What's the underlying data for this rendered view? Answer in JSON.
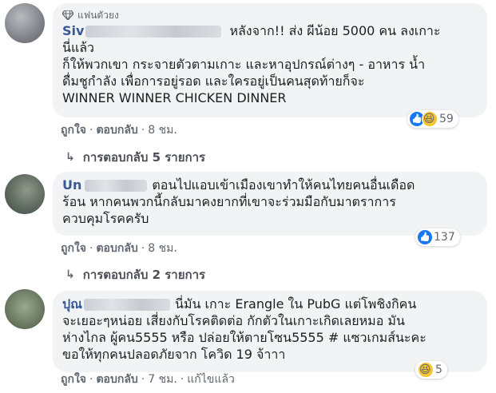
{
  "comments": [
    {
      "top_fan": "แฟนตัวยง",
      "name": "Siv",
      "text_line1": "หลังจาก!! ส่ง ผีน้อย 5000 คน ลงเกาะ",
      "text_lines": [
        "นี่แล้ว",
        "ก็ให้พวกเขา กระจายตัวตามเกาะ และหาอุปกรณ์ต่างๆ - อาหาร น้ำ",
        "ดื่มชูกำลัง เพื่อการอยู่รอด และใครอยู่เป็นคนสุดท้ายก็จะ",
        "WINNER WINNER CHICKEN DINNER"
      ],
      "reactions": [
        "like-icon",
        "haha-icon"
      ],
      "reaction_count": "59",
      "like": "ถูกใจ",
      "reply": "ตอบกลับ",
      "time": "8 ชม.",
      "replies_link": "การตอบกลับ 5 รายการ"
    },
    {
      "name": "Un",
      "text_line1": "ตอนไปแอบเข้าเมืองเขาทำให้คนไทยคนอื่นเดือด",
      "text_lines": [
        "ร้อน หากคนพวกนี้กลับมาคงยากที่เขาจะร่วมมือกับมาตราการ",
        "ควบคุมโรคครับ"
      ],
      "reactions": [
        "like-icon"
      ],
      "reaction_count": "137",
      "like": "ถูกใจ",
      "reply": "ตอบกลับ",
      "time": "8 ชม.",
      "replies_link": "การตอบกลับ 2 รายการ"
    },
    {
      "name": "ปุณ",
      "text_line1": "นี่มัน เกาะ Erangle ใน PubG แต่โพชิงกิคน",
      "text_lines": [
        "จะเยอะๆหน่อย เสี่ยงกับโรคติดต่อ กักตัวในเกาะเกิดเลยหมอ มัน",
        "ห่างไกล ผู้คน5555 หรือ ปล่อยให้ตายโซน5555 # แซวเกมส์นะคะ",
        "ขอให้ทุกคนปลอดภัยจาก โควิด 19 จ้าาา"
      ],
      "reactions": [
        "haha-icon"
      ],
      "reaction_count": "5",
      "like": "ถูกใจ",
      "reply": "ตอบกลับ",
      "time": "7 ชม.",
      "edited": "แก้ไขแล้ว"
    }
  ],
  "colors": {
    "name": "#385898",
    "bubble": "#f2f3f5",
    "like_blue": "#1877f2",
    "meta": "#606770"
  }
}
